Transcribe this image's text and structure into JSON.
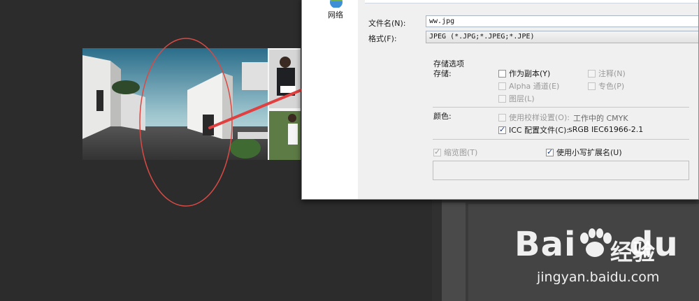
{
  "sidebar": {
    "network_label": "网络"
  },
  "dialog": {
    "filename_label": "文件名(N):",
    "filename_value": "ww.jpg",
    "format_label": "格式(F):",
    "format_value": "JPEG (*.JPG;*.JPEG;*.JPE)",
    "save_options_title": "存储选项",
    "save_label": "存储:",
    "color_label": "颜色:",
    "options": {
      "as_copy": "作为副本(Y)",
      "notes": "注释(N)",
      "alpha": "Alpha 通道(E)",
      "spot": "专色(P)",
      "layers": "图层(L)",
      "proof": "使用校样设置(O):",
      "proof_value": "工作中的 CMYK",
      "icc": "ICC 配置文件(C):",
      "icc_value": "sRGB IEC61966-2.1",
      "thumbnail": "缩览图(T)",
      "lowercase_ext": "使用小写扩展名(U)"
    }
  },
  "watermark": {
    "brand": "Bai",
    "brand_suffix": "du",
    "brand_cn": "经验",
    "url": "jingyan.baidu.com"
  },
  "colors": {
    "annotation_red": "#e04040",
    "dialog_bg": "#f0f0f0",
    "canvas_bg": "#2c2c2c"
  }
}
